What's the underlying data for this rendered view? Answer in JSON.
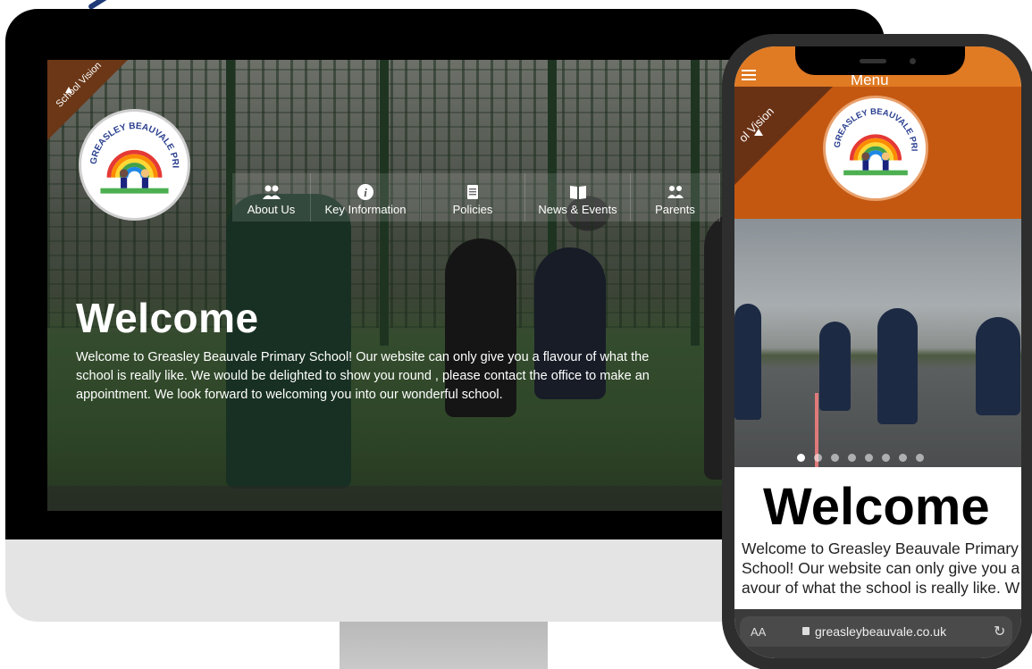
{
  "desktop": {
    "vision_label": "School Vision",
    "nav": [
      {
        "label": "About Us",
        "icon": "users-icon"
      },
      {
        "label": "Key Information",
        "icon": "info-icon"
      },
      {
        "label": "Policies",
        "icon": "document-icon"
      },
      {
        "label": "News & Events",
        "icon": "book-icon"
      },
      {
        "label": "Parents",
        "icon": "parents-icon"
      }
    ],
    "welcome_title": "Welcome",
    "welcome_text": "Welcome to Greasley Beauvale Primary School! Our website can only give you a flavour of what the school is really like. We would be delighted to show you round , please contact the office to make an appointment. We look forward to welcoming you into our wonderful school."
  },
  "phone": {
    "menu_label": "Menu",
    "vision_label": "ol Vision",
    "welcome_title": "Welcome",
    "welcome_text_lines": [
      "Welcome to Greasley Beauvale Primary",
      "School! Our website can only give you a",
      "avour of what the school is really like. W"
    ],
    "slides": {
      "count": 8,
      "active": 0
    },
    "url_bar": {
      "aa": "AA",
      "url": "greasleybeauvale.co.uk",
      "reload_icon": "reload-icon"
    }
  },
  "logo": {
    "text": "GREASLEY BEAUVALE PRIMARY SCHOOL"
  },
  "colors": {
    "orange_bar": "#e07a23",
    "orange_header": "#c45811",
    "ribbon": "#6b3716"
  }
}
